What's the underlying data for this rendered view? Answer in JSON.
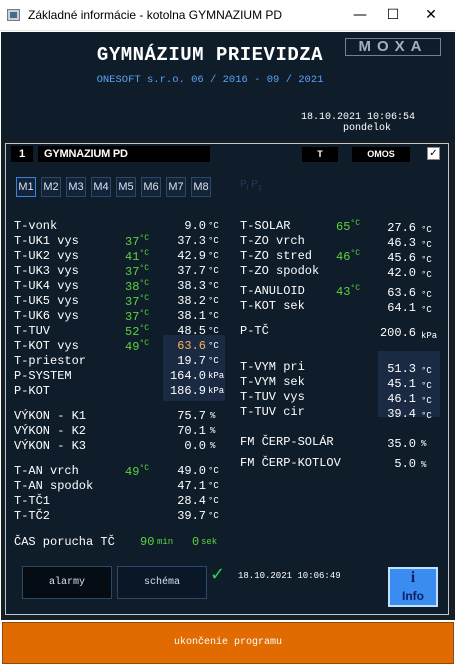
{
  "window": {
    "title": "Základné informácie - kotolna GYMNAZIUM PD",
    "minimize": "—",
    "maximize": "☐",
    "close": "✕"
  },
  "header": {
    "title": "GYMNÁZIUM PRIEVIDZA",
    "subtitle": "ONESOFT s.r.o. 06 / 2016 - 09 / 2021",
    "logo": "MOXA",
    "datetime": "18.10.2021 10:06:54",
    "day": "pondelok"
  },
  "panel": {
    "number": "1",
    "name": "GYMNAZIUM PD",
    "t_button": "T",
    "omos_button": "OMOS",
    "checkbox": "✓"
  },
  "modules": [
    "M1",
    "M2",
    "M3",
    "M4",
    "M5",
    "M6",
    "M7",
    "M8"
  ],
  "pip": {
    "p1": "P",
    "sub1": "i",
    "p2": "P",
    "sub2": "z"
  },
  "deg": "°C",
  "left": {
    "t_vonk": {
      "label": "T-vonk",
      "value": "9.0"
    },
    "t_uk1": {
      "label": "T-UK1 vys",
      "set": "37",
      "value": "37.3"
    },
    "t_uk2": {
      "label": "T-UK2 vys",
      "set": "41",
      "value": "42.9"
    },
    "t_uk3": {
      "label": "T-UK3 vys",
      "set": "37",
      "value": "37.7"
    },
    "t_uk4": {
      "label": "T-UK4 vys",
      "set": "38",
      "value": "38.3"
    },
    "t_uk5": {
      "label": "T-UK5 vys",
      "set": "37",
      "value": "38.2"
    },
    "t_uk6": {
      "label": "T-UK6 vys",
      "set": "37",
      "value": "38.1"
    },
    "t_tuv": {
      "label": "T-TUV",
      "set": "52",
      "value": "48.5"
    },
    "t_kot": {
      "label": "T-KOT vys",
      "set": "49",
      "value": "63.6"
    },
    "t_priestor": {
      "label": "T-priestor",
      "value": "19.7"
    },
    "p_system": {
      "label": "P-SYSTEM",
      "value": "164.0",
      "unit": "kPa"
    },
    "p_kot": {
      "label": "P-KOT",
      "value": "186.9",
      "unit": "kPa"
    },
    "vykon_k1": {
      "label": "VÝKON - K1",
      "value": "75.7",
      "unit": "%"
    },
    "vykon_k2": {
      "label": "VÝKON - K2",
      "value": "70.1",
      "unit": "%"
    },
    "vykon_k3": {
      "label": "VÝKON - K3",
      "value": "0.0",
      "unit": "%"
    },
    "t_an_vrch": {
      "label": "T-AN vrch",
      "set": "49",
      "value": "49.0"
    },
    "t_an_spodok": {
      "label": "T-AN spodok",
      "value": "47.1"
    },
    "t_tc1": {
      "label": "T-TČ1",
      "value": "28.4"
    },
    "t_tc2": {
      "label": "T-TČ2",
      "value": "39.7"
    },
    "cas": {
      "label": "ČAS porucha TČ",
      "min": "90",
      "min_unit": "min",
      "sek": "0",
      "sek_unit": "sek"
    }
  },
  "right": {
    "t_solar": {
      "label": "T-SOLAR",
      "set": "65",
      "value": "27.6"
    },
    "t_zo_vrch": {
      "label": "T-ZO vrch",
      "value": "46.3"
    },
    "t_zo_stred": {
      "label": "T-ZO stred",
      "set": "46",
      "value": "45.6"
    },
    "t_zo_spodok": {
      "label": "T-ZO spodok",
      "value": "42.0"
    },
    "t_anuloid": {
      "label": "T-ANULOID",
      "set": "43",
      "value": "63.6"
    },
    "t_kot_sek": {
      "label": "T-KOT sek",
      "value": "64.1"
    },
    "p_tc": {
      "label": "P-TČ",
      "value": "200.6",
      "unit": "kPa"
    },
    "t_vym_pri": {
      "label": "T-VYM pri",
      "value": "51.3"
    },
    "t_vym_sek": {
      "label": "T-VYM sek",
      "value": "45.1"
    },
    "t_tuv_vys": {
      "label": "T-TUV vys",
      "value": "46.1"
    },
    "t_tuv_cir": {
      "label": "T-TUV cir",
      "value": "39.4"
    },
    "fm_solar": {
      "label": "FM ČERP-SOLÁR",
      "value": "35.0",
      "unit": "%"
    },
    "fm_kotlov": {
      "label": "FM ČERP-KOTLOV",
      "value": "5.0",
      "unit": "%"
    }
  },
  "bottom": {
    "alarmy": "alarmy",
    "schema": "schéma",
    "ok_icon": "✓",
    "datetime": "18.10.2021 10:06:49",
    "info_i": "i",
    "info_label": "Info"
  },
  "footer": {
    "exit": "ukončenie programu"
  }
}
